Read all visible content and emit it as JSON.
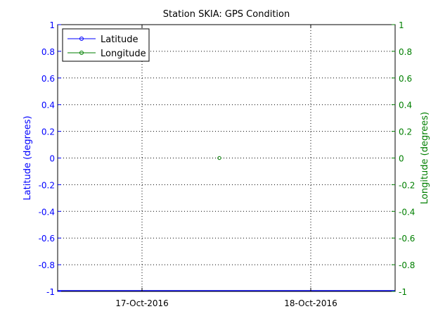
{
  "chart_data": {
    "type": "line",
    "title": "Station SKIA: GPS Condition",
    "ylabel_left": "Latitude (degrees)",
    "ylabel_right": "Longitude (degrees)",
    "ylim": [
      -1,
      1
    ],
    "yticks": [
      -1,
      -0.8,
      -0.6,
      -0.4,
      -0.2,
      0,
      0.2,
      0.4,
      0.6,
      0.8,
      1
    ],
    "ytick_labels": [
      "-1",
      "-0.8",
      "-0.6",
      "-0.4",
      "-0.2",
      "0",
      "0.2",
      "0.4",
      "0.6",
      "0.8",
      "1"
    ],
    "xlim": [
      "2016-10-16T12:00",
      "2016-10-18T12:00"
    ],
    "xticks": [
      "2016-10-17",
      "2016-10-18"
    ],
    "xtick_labels": [
      "17-Oct-2016",
      "18-Oct-2016"
    ],
    "grid": true,
    "legend_position": "top-left",
    "series": [
      {
        "name": "Latitude",
        "axis": "left",
        "color": "#0000ff",
        "marker": "circle",
        "points": []
      },
      {
        "name": "Longitude",
        "axis": "right",
        "color": "#007f00",
        "marker": "circle",
        "points": [
          {
            "x": "2016-10-17T11:00",
            "y": 0
          }
        ]
      }
    ]
  }
}
